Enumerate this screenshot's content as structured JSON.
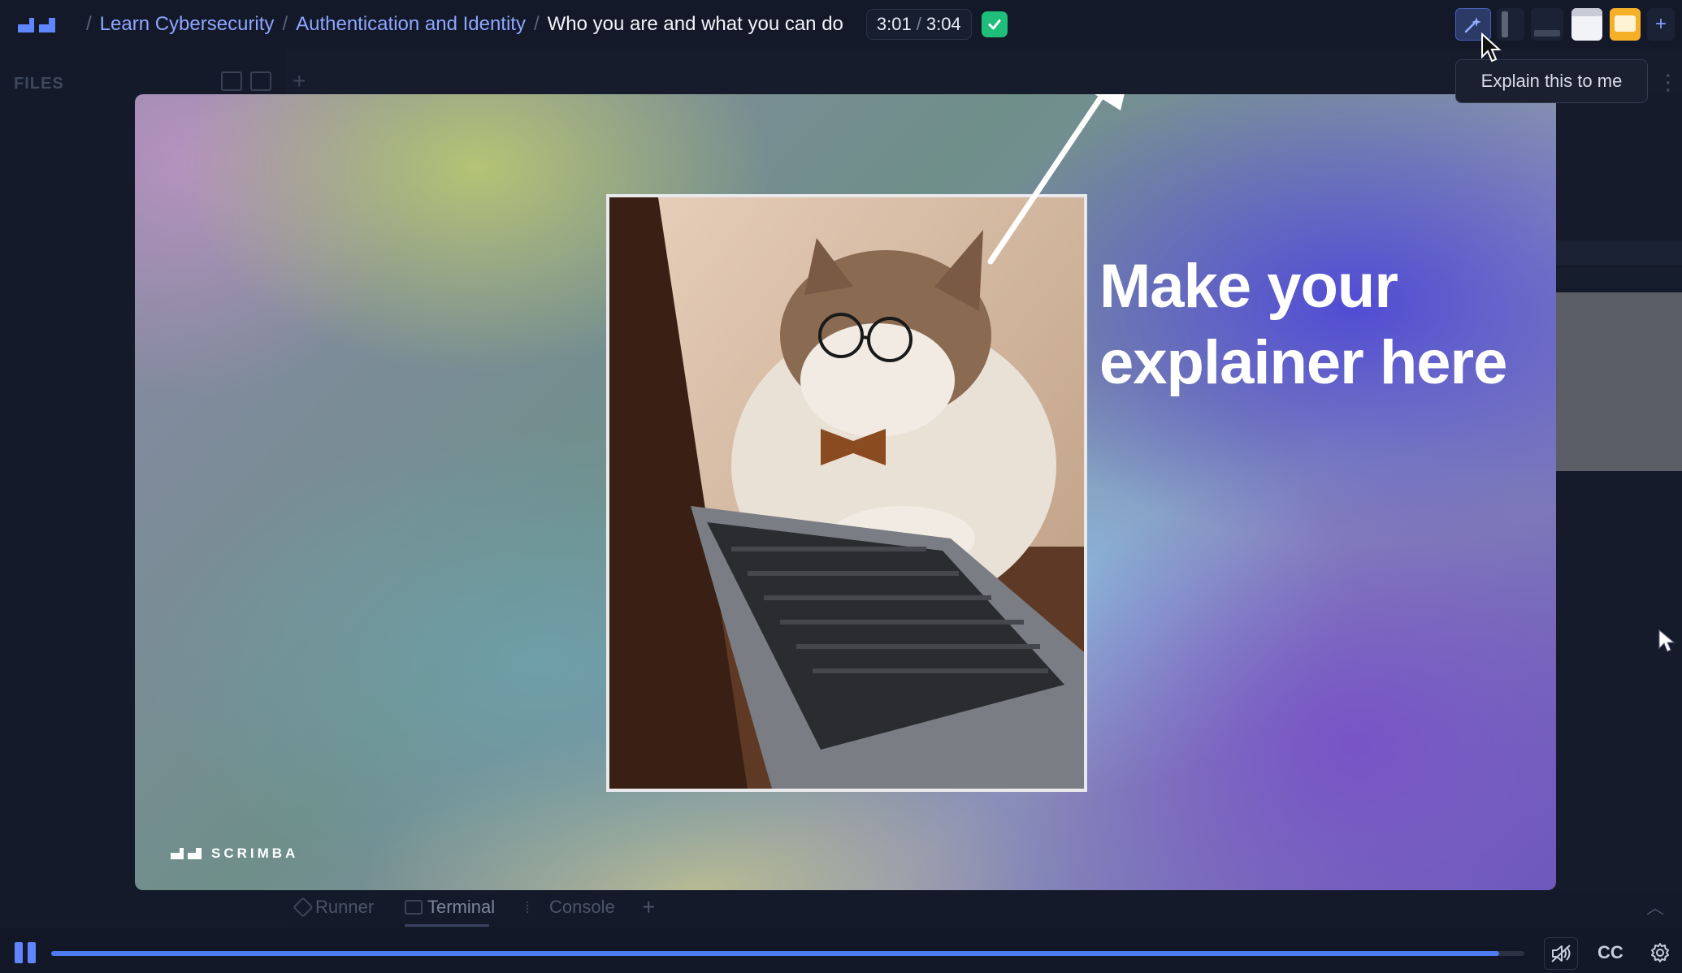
{
  "breadcrumb": {
    "items": [
      "Learn Cybersecurity",
      "Authentication and Identity"
    ],
    "current": "Who you are and what you can do",
    "separator": "/"
  },
  "timer": {
    "elapsed": "3:01",
    "total": "3:04",
    "separator": "/"
  },
  "files": {
    "label": "FILES"
  },
  "tooltip": {
    "text": "Explain this to me"
  },
  "video": {
    "headline_line1": "Make your",
    "headline_line2": "explainer here",
    "brand": "SCRIMBA"
  },
  "console_tabs": {
    "runner": "Runner",
    "terminal": "Terminal",
    "console": "Console",
    "add": "+"
  },
  "player": {
    "cc_label": "CC",
    "progress": 0.983
  },
  "toolbar": {
    "add": "+"
  },
  "colors": {
    "accent": "#5f86ff",
    "link": "#8ea6ff",
    "success": "#1fbf7b",
    "slides": "#f5b027"
  },
  "icons": [
    "scrimba-logo-icon",
    "check-icon",
    "explain-icon",
    "split-vertical-icon",
    "split-horizontal-icon",
    "browser-icon",
    "slides-icon",
    "plus-icon",
    "new-file-icon",
    "new-folder-icon",
    "pause-icon",
    "mute-icon",
    "settings-icon",
    "cursor-icon"
  ]
}
